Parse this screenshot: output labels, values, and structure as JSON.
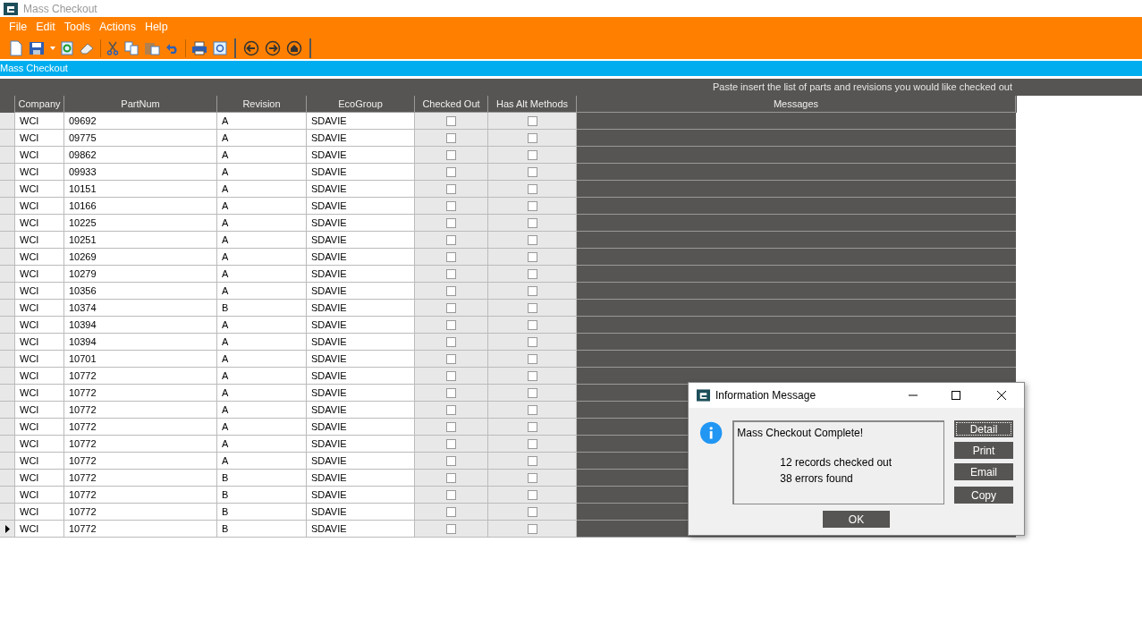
{
  "window": {
    "title": "Mass Checkout"
  },
  "menu": [
    "File",
    "Edit",
    "Tools",
    "Actions",
    "Help"
  ],
  "panel_title": "Mass Checkout",
  "instruction": "Paste insert the list of parts and revisions you would like checked out",
  "table": {
    "columns": [
      "Company",
      "PartNum",
      "Revision",
      "EcoGroup",
      "Checked Out",
      "Has Alt Methods",
      "Messages"
    ],
    "rows": [
      {
        "company": "WCI",
        "part": "09692",
        "revision": "A",
        "eco": "SDAVIE",
        "checked_out": false,
        "has_alt": false,
        "current": false
      },
      {
        "company": "WCI",
        "part": "09775",
        "revision": "A",
        "eco": "SDAVIE",
        "checked_out": false,
        "has_alt": false,
        "current": false
      },
      {
        "company": "WCI",
        "part": "09862",
        "revision": "A",
        "eco": "SDAVIE",
        "checked_out": false,
        "has_alt": false,
        "current": false
      },
      {
        "company": "WCI",
        "part": "09933",
        "revision": "A",
        "eco": "SDAVIE",
        "checked_out": false,
        "has_alt": false,
        "current": false
      },
      {
        "company": "WCI",
        "part": "10151",
        "revision": "A",
        "eco": "SDAVIE",
        "checked_out": false,
        "has_alt": false,
        "current": false
      },
      {
        "company": "WCI",
        "part": "10166",
        "revision": "A",
        "eco": "SDAVIE",
        "checked_out": false,
        "has_alt": false,
        "current": false
      },
      {
        "company": "WCI",
        "part": "10225",
        "revision": "A",
        "eco": "SDAVIE",
        "checked_out": false,
        "has_alt": false,
        "current": false
      },
      {
        "company": "WCI",
        "part": "10251",
        "revision": "A",
        "eco": "SDAVIE",
        "checked_out": false,
        "has_alt": false,
        "current": false
      },
      {
        "company": "WCI",
        "part": "10269",
        "revision": "A",
        "eco": "SDAVIE",
        "checked_out": false,
        "has_alt": false,
        "current": false
      },
      {
        "company": "WCI",
        "part": "10279",
        "revision": "A",
        "eco": "SDAVIE",
        "checked_out": false,
        "has_alt": false,
        "current": false
      },
      {
        "company": "WCI",
        "part": "10356",
        "revision": "A",
        "eco": "SDAVIE",
        "checked_out": false,
        "has_alt": false,
        "current": false
      },
      {
        "company": "WCI",
        "part": "10374",
        "revision": "B",
        "eco": "SDAVIE",
        "checked_out": false,
        "has_alt": false,
        "current": false
      },
      {
        "company": "WCI",
        "part": "10394",
        "revision": "A",
        "eco": "SDAVIE",
        "checked_out": false,
        "has_alt": false,
        "current": false
      },
      {
        "company": "WCI",
        "part": "10394",
        "revision": "A",
        "eco": "SDAVIE",
        "checked_out": false,
        "has_alt": false,
        "current": false
      },
      {
        "company": "WCI",
        "part": "10701",
        "revision": "A",
        "eco": "SDAVIE",
        "checked_out": false,
        "has_alt": false,
        "current": false
      },
      {
        "company": "WCI",
        "part": "10772",
        "revision": "A",
        "eco": "SDAVIE",
        "checked_out": false,
        "has_alt": false,
        "current": false
      },
      {
        "company": "WCI",
        "part": "10772",
        "revision": "A",
        "eco": "SDAVIE",
        "checked_out": false,
        "has_alt": false,
        "current": false
      },
      {
        "company": "WCI",
        "part": "10772",
        "revision": "A",
        "eco": "SDAVIE",
        "checked_out": false,
        "has_alt": false,
        "current": false
      },
      {
        "company": "WCI",
        "part": "10772",
        "revision": "A",
        "eco": "SDAVIE",
        "checked_out": false,
        "has_alt": false,
        "current": false
      },
      {
        "company": "WCI",
        "part": "10772",
        "revision": "A",
        "eco": "SDAVIE",
        "checked_out": false,
        "has_alt": false,
        "current": false
      },
      {
        "company": "WCI",
        "part": "10772",
        "revision": "A",
        "eco": "SDAVIE",
        "checked_out": false,
        "has_alt": false,
        "current": false
      },
      {
        "company": "WCI",
        "part": "10772",
        "revision": "B",
        "eco": "SDAVIE",
        "checked_out": false,
        "has_alt": false,
        "current": false
      },
      {
        "company": "WCI",
        "part": "10772",
        "revision": "B",
        "eco": "SDAVIE",
        "checked_out": false,
        "has_alt": false,
        "current": false
      },
      {
        "company": "WCI",
        "part": "10772",
        "revision": "B",
        "eco": "SDAVIE",
        "checked_out": false,
        "has_alt": false,
        "current": false
      },
      {
        "company": "WCI",
        "part": "10772",
        "revision": "B",
        "eco": "SDAVIE",
        "checked_out": false,
        "has_alt": false,
        "current": true
      }
    ]
  },
  "dialog": {
    "title": "Information Message",
    "message_lines": [
      "Mass Checkout Complete!",
      "12 records checked out",
      "38 errors found"
    ],
    "side_buttons": [
      {
        "label": "Detail",
        "focused": true
      },
      {
        "label": "Print",
        "focused": false
      },
      {
        "label": "Email",
        "focused": false
      },
      {
        "label": "Copy",
        "focused": false
      }
    ],
    "ok": "OK"
  }
}
